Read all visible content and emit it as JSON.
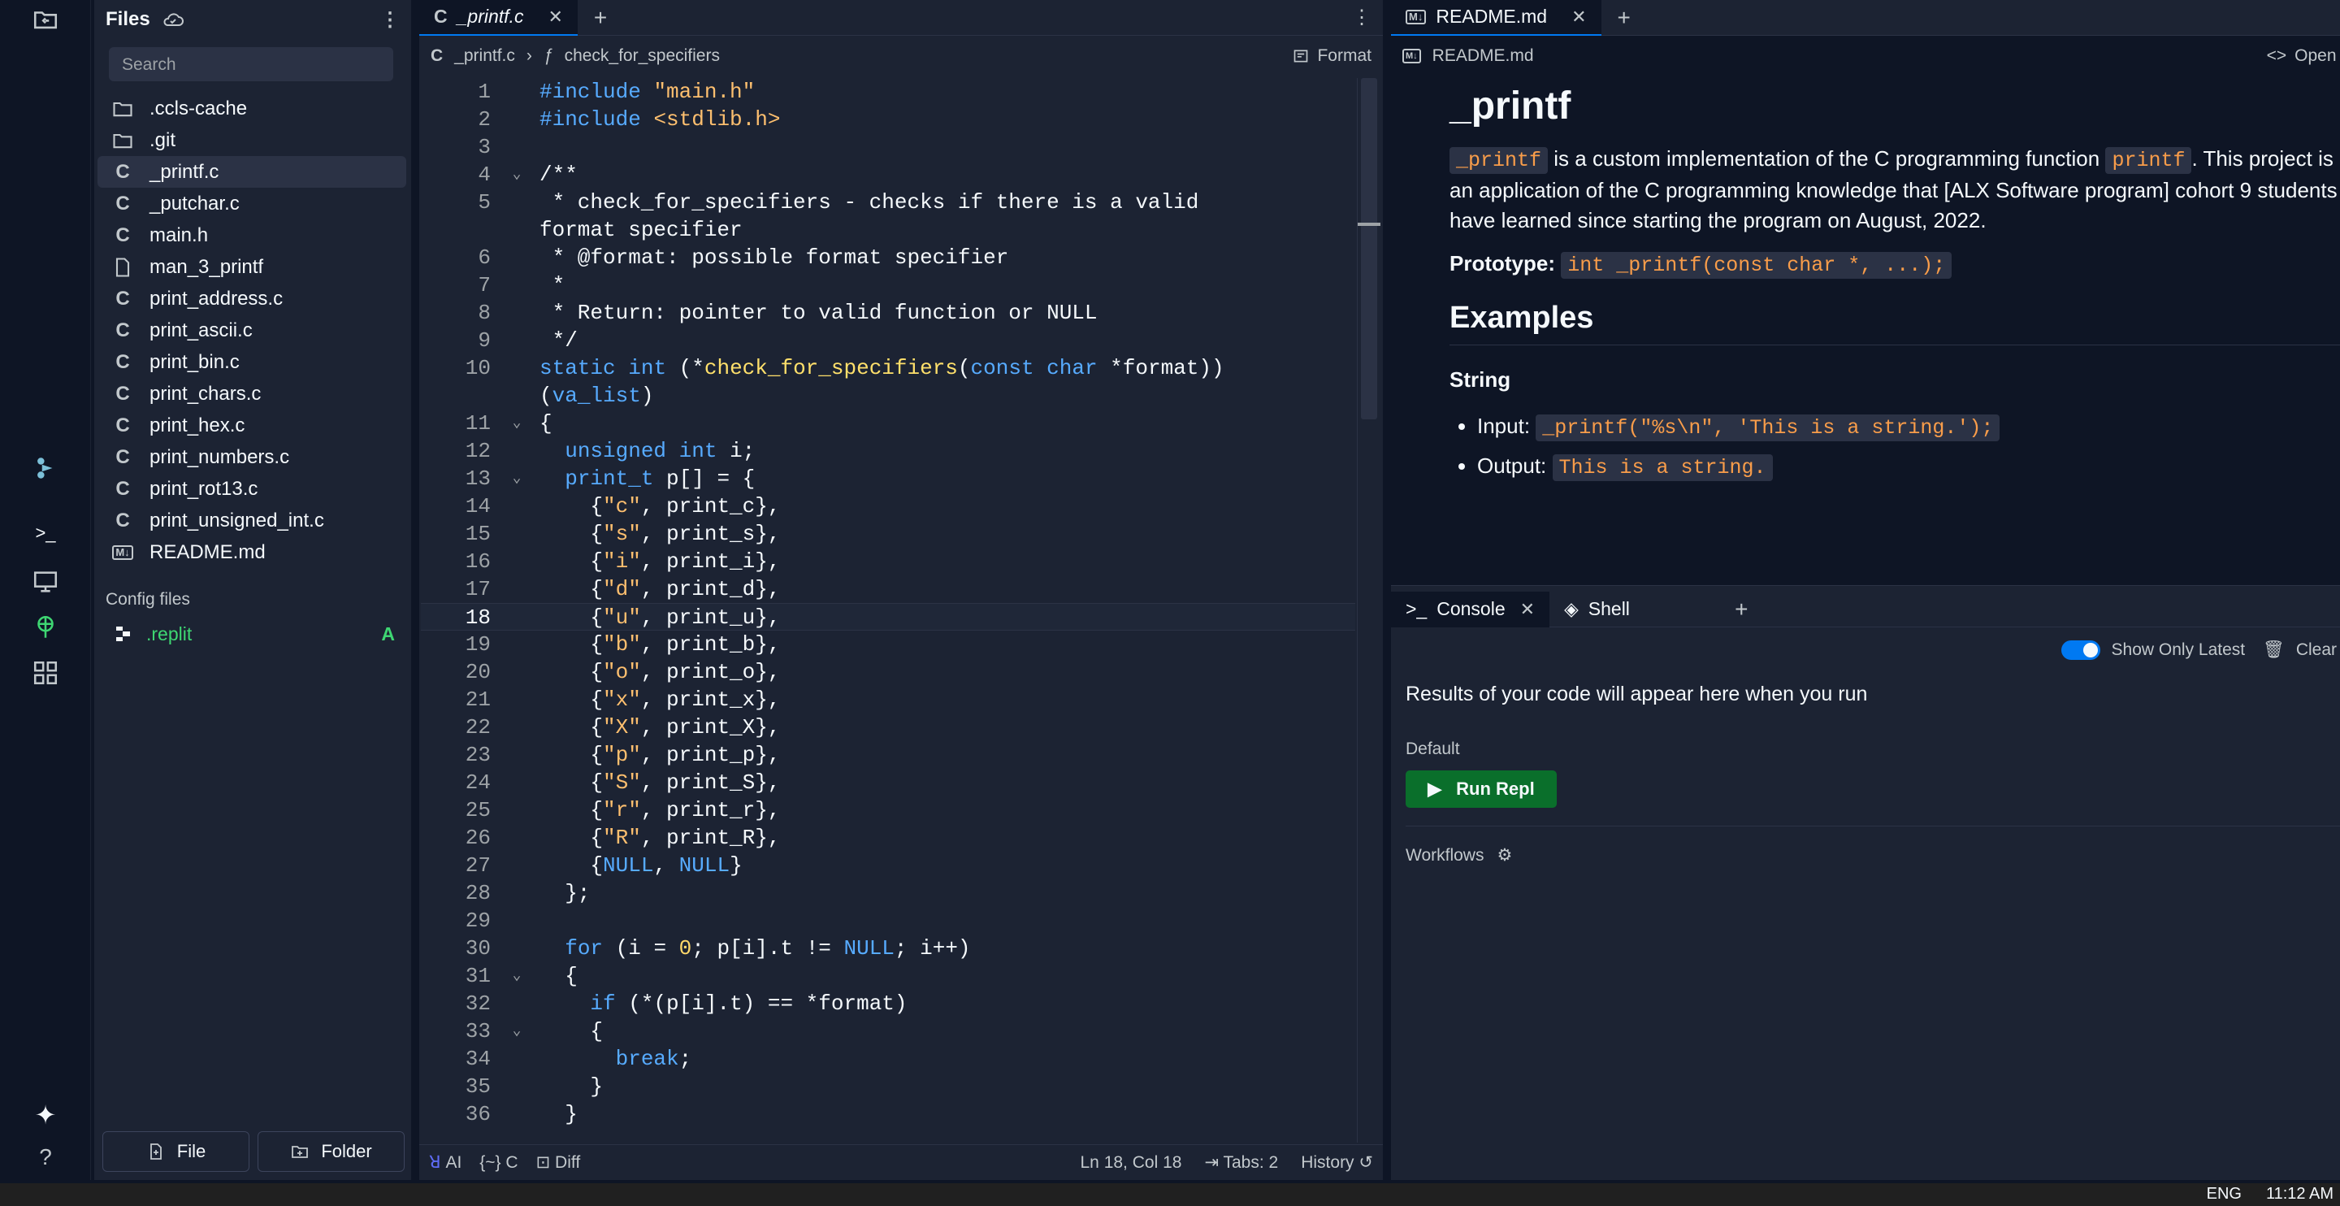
{
  "files_panel": {
    "title": "Files",
    "search_placeholder": "Search",
    "items": [
      {
        "name": ".ccls-cache",
        "icon": "folder-icon"
      },
      {
        "name": ".git",
        "icon": "folder-icon"
      },
      {
        "name": "_printf.c",
        "icon": "c-file-icon"
      },
      {
        "name": "_putchar.c",
        "icon": "c-file-icon"
      },
      {
        "name": "main.h",
        "icon": "c-file-icon"
      },
      {
        "name": "man_3_printf",
        "icon": "file-icon"
      },
      {
        "name": "print_address.c",
        "icon": "c-file-icon"
      },
      {
        "name": "print_ascii.c",
        "icon": "c-file-icon"
      },
      {
        "name": "print_bin.c",
        "icon": "c-file-icon"
      },
      {
        "name": "print_chars.c",
        "icon": "c-file-icon"
      },
      {
        "name": "print_hex.c",
        "icon": "c-file-icon"
      },
      {
        "name": "print_numbers.c",
        "icon": "c-file-icon"
      },
      {
        "name": "print_rot13.c",
        "icon": "c-file-icon"
      },
      {
        "name": "print_unsigned_int.c",
        "icon": "c-file-icon"
      },
      {
        "name": "README.md",
        "icon": "markdown-icon"
      }
    ],
    "config_label": "Config files",
    "config_item": ".replit",
    "config_flag": "A",
    "file_button": "File",
    "folder_button": "Folder"
  },
  "editor": {
    "tab_label": "_printf.c",
    "breadcrumb_file": "_printf.c",
    "breadcrumb_symbol": "check_for_specifiers",
    "format_label": "Format",
    "md_badge": "M↓",
    "status": {
      "ai": "AI",
      "lang": "C",
      "diff": "Diff",
      "position": "Ln 18, Col 18",
      "tabs": "Tabs: 2",
      "history": "History"
    }
  },
  "readme": {
    "tab_label": "README.md",
    "breadcrumb": "README.md",
    "open_label": "Open i",
    "h1": "_printf",
    "intro_code1": "_printf",
    "intro_text1": " is a custom implementation of the C programming function ",
    "intro_code2": "printf",
    "intro_text2": ". This project is an application of the C programming knowledge that [ALX Software program] cohort 9 students have learned since starting the program on August, 2022.",
    "prototype_label": "Prototype:",
    "prototype_code": "int _printf(const char *, ...);",
    "h2": "Examples",
    "h3": "String",
    "input_label": "Input:",
    "input_code": "_printf(\"%s\\n\", 'This is a string.');",
    "output_label": "Output:",
    "output_code": "This is a string."
  },
  "console": {
    "tab_console": "Console",
    "tab_shell": "Shell",
    "show_only_latest": "Show Only Latest",
    "clear": "Clear",
    "message": "Results of your code will appear here when you run",
    "default_label": "Default",
    "run_button": "Run Repl",
    "workflows": "Workflows"
  },
  "taskbar": {
    "lang": "ENG",
    "time": "11:12 AM"
  }
}
